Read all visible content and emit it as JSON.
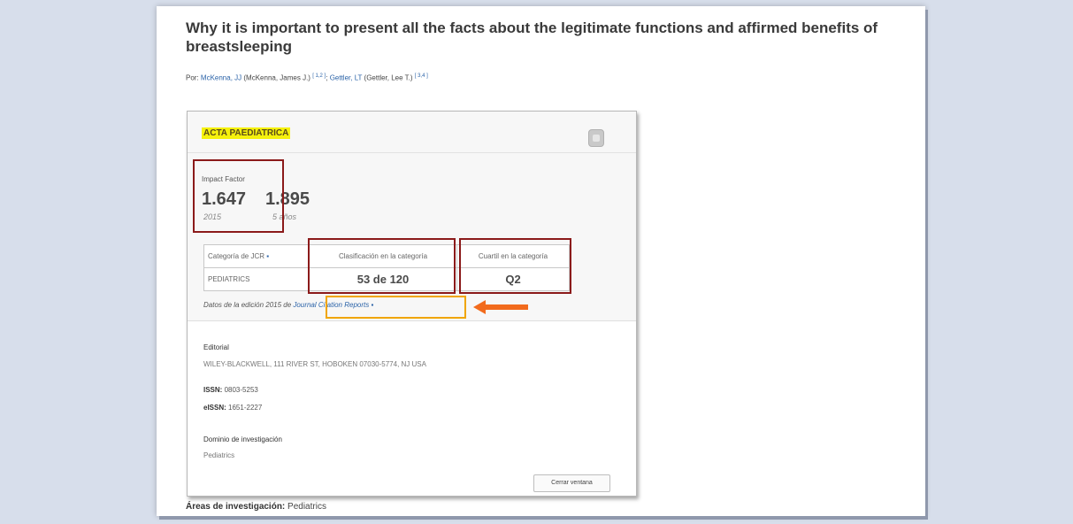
{
  "article": {
    "title": "Why it is important to present all the facts about the legitimate functions and affirmed benefits of breastsleeping",
    "by_label": "Por:",
    "author1": "McKenna, JJ",
    "author1_full": "(McKenna, James J.)",
    "author1_refs": "[ 1,2 ]",
    "separator": ";",
    "author2": "Gettler, LT",
    "author2_full": "(Gettler, Lee T.)",
    "author2_refs": "[ 3,4 ]",
    "areas_label": "Áreas de investigación:",
    "areas_value": "Pediatrics"
  },
  "popup": {
    "journal_name": "ACTA PAEDIATRICA",
    "impact_factor_label": "Impact Factor",
    "if_value_1": "1.647",
    "if_year_1": "2015",
    "if_value_2": "1.895",
    "if_year_2": "5 años",
    "table": {
      "header_category": "Categoría de JCR",
      "header_rank": "Clasificación en la categoría",
      "header_quartile": "Cuartil en la categoría",
      "category": "PEDIATRICS",
      "rank": "53 de 120",
      "quartile": "Q2"
    },
    "edition_text": "Datos de la edición 2015 de",
    "edition_link": "Journal Citation Reports",
    "editorial_label": "Editorial",
    "editorial_value": "WILEY-BLACKWELL, 111 RIVER ST, HOBOKEN 07030-5774, NJ USA",
    "issn_label": "ISSN:",
    "issn_value": "0803-5253",
    "eissn_label": "eISSN:",
    "eissn_value": "1651-2227",
    "domain_label": "Dominio de investigación",
    "domain_value": "Pediatrics",
    "close_button": "Cerrar ventana"
  },
  "colors": {
    "highlight": "#f5f10d",
    "red_annotation": "#8b1a1a",
    "orange_annotation": "#f0a500",
    "arrow": "#f26b1d",
    "link": "#2b63a8"
  }
}
